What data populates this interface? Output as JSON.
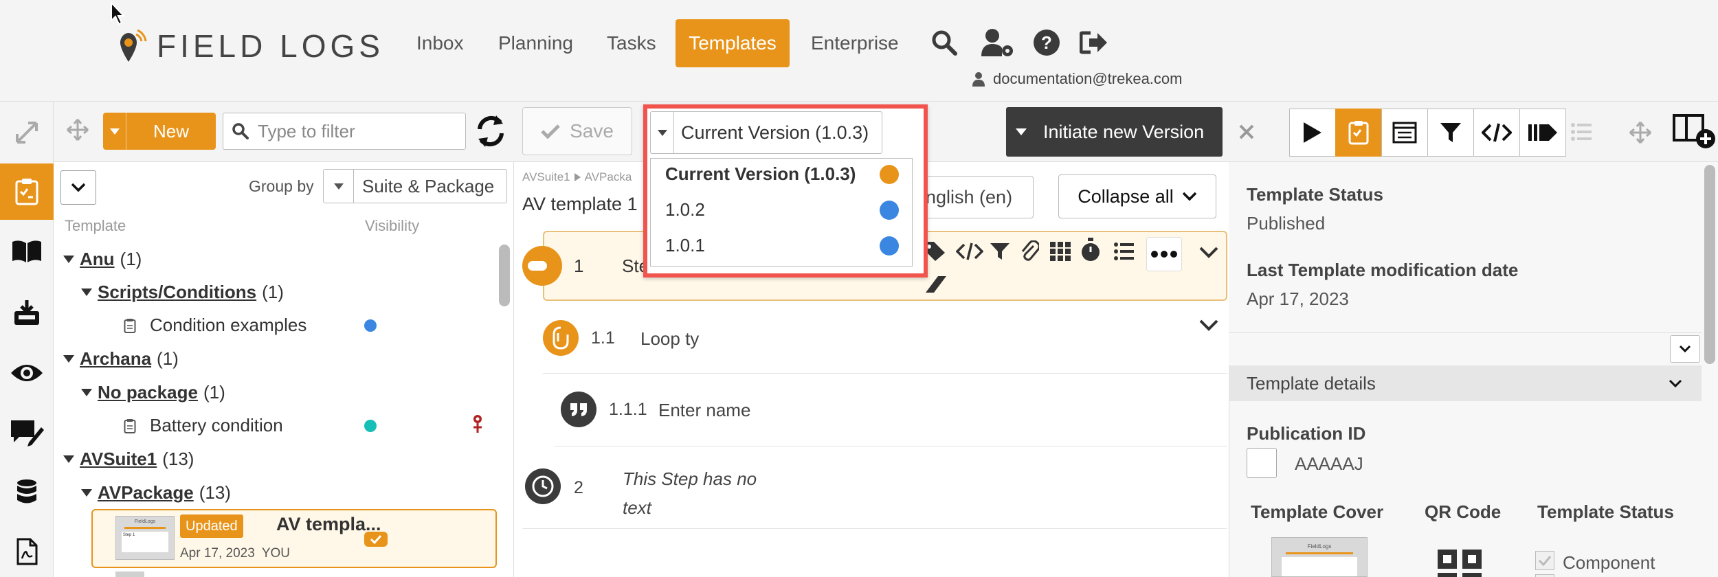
{
  "header": {
    "brand": "FIELD LOGS",
    "nav": [
      {
        "label": "Inbox",
        "active": false
      },
      {
        "label": "Planning",
        "active": false
      },
      {
        "label": "Tasks",
        "active": false
      },
      {
        "label": "Templates",
        "active": true
      },
      {
        "label": "Enterprise",
        "active": false
      }
    ],
    "user_email": "documentation@trekea.com"
  },
  "colors": {
    "accent": "#e8941a",
    "dark_button": "#3b3b3b",
    "highlight_border": "#f0544d",
    "status_blue": "#3a86e0",
    "status_teal": "#16c0b6",
    "pin_red": "#b22222"
  },
  "tree": {
    "new_label": "New",
    "filter_placeholder": "Type to filter",
    "group_by_label": "Group by",
    "group_by_value": "Suite & Package",
    "col_template": "Template",
    "col_visibility": "Visibility",
    "groups": [
      {
        "name": "Anu",
        "count": "(1)"
      },
      {
        "name": "Scripts/Conditions",
        "count": "(1)"
      },
      {
        "name": "Archana",
        "count": "(1)"
      },
      {
        "name": "No package",
        "count": "(1)"
      },
      {
        "name": "AVSuite1",
        "count": "(13)"
      },
      {
        "name": "AVPackage",
        "count": "(13)"
      }
    ],
    "items": [
      {
        "label": "Condition examples"
      },
      {
        "label": "Battery condition"
      }
    ],
    "card": {
      "badge": "Updated",
      "title": "AV templa...",
      "date": "Apr 17, 2023",
      "owner": "YOU",
      "thumb_brand": "FieldLogs",
      "thumb_text": "Step 1"
    }
  },
  "editor": {
    "save_label": "Save",
    "version_selected": "Current Version (1.0.3)",
    "versions": [
      {
        "label": "Current Version (1.0.3)",
        "color": "#e8941a",
        "current": true
      },
      {
        "label": "1.0.2",
        "color": "#3a86e0",
        "current": false
      },
      {
        "label": "1.0.1",
        "color": "#3a86e0",
        "current": false
      }
    ],
    "initiate_label": "Initiate new Version",
    "breadcrumb_suite": "AVSuite1",
    "breadcrumb_pkg": "AVPacka",
    "template_title": "AV template 1",
    "language": "nglish (en)",
    "collapse_label": "Collapse all",
    "steps": [
      {
        "num": "1",
        "text": "Step 1"
      },
      {
        "num": "1.1",
        "text": "Loop ty"
      },
      {
        "num": "1.1.1",
        "text": "Enter name"
      },
      {
        "num": "2",
        "text_line1": "This Step has no",
        "text_line2": "text"
      }
    ]
  },
  "right": {
    "status_label": "Template Status",
    "status_value": "Published",
    "mod_label": "Last Template modification date",
    "mod_value": "Apr 17, 2023",
    "details_label": "Template details",
    "pub_label": "Publication ID",
    "pub_value": "AAAAAJ",
    "cover_label": "Template Cover",
    "qr_label": "QR Code",
    "status2_label": "Template Status",
    "component_label": "Component",
    "cover_brand": "FieldLogs"
  }
}
